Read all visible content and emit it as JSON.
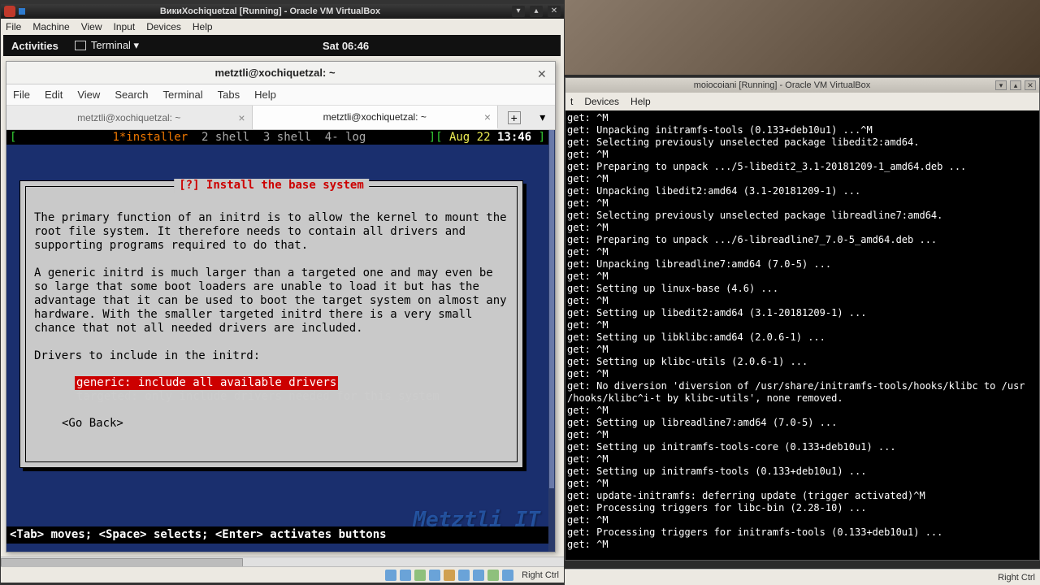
{
  "vm1": {
    "title": "ВикиXochiquetzal [Running] - Oracle VM VirtualBox",
    "menu": [
      "File",
      "Machine",
      "View",
      "Input",
      "Devices",
      "Help"
    ],
    "titlebtns": [
      "▾",
      "▴",
      "✕"
    ],
    "status_right": "Right Ctrl"
  },
  "gnome": {
    "activities": "Activities",
    "app": "Terminal ▾",
    "clock": "Sat 06:46"
  },
  "termwin": {
    "title": "metztli@xochiquetzal: ~",
    "menu": [
      "File",
      "Edit",
      "View",
      "Search",
      "Terminal",
      "Tabs",
      "Help"
    ],
    "tabs": [
      "metztli@xochiquetzal: ~",
      "metztli@xochiquetzal: ~"
    ],
    "status": {
      "left_items": [
        "1*installer",
        "2 shell",
        "3 shell",
        "4- log"
      ],
      "pre_date": "Aug 22",
      "time": "13:46"
    }
  },
  "installer": {
    "title": "[?] Install the base system",
    "p1": "The primary function of an initrd is to allow the kernel to mount the root file system. It therefore needs to contain all drivers and supporting programs required to do that.",
    "p2": "A generic initrd is much larger than a targeted one and may even be so large that some boot loaders are unable to load it but has the advantage that it can be used to boot the target system on almost any hardware. With the smaller targeted initrd there is a very small chance that not all needed drivers are included.",
    "prompt": "Drivers to include in the initrd:",
    "opt_generic": "generic: include all available drivers",
    "opt_targeted": "targeted: only include drivers needed for this system",
    "goback": "<Go Back>",
    "help": "<Tab> moves; <Space> selects; <Enter> activates buttons"
  },
  "watermark": "Metztli IT",
  "vm2": {
    "title": "moiocoiani [Running] - Oracle VM VirtualBox",
    "menu_visible": [
      "t",
      "Devices",
      "Help"
    ],
    "titlebtns": [
      "▾",
      "▴",
      "✕"
    ],
    "status_right": "Right Ctrl",
    "lines": [
      "get: ^M",
      "get: Unpacking initramfs-tools (0.133+deb10u1) ...^M",
      "get: Selecting previously unselected package libedit2:amd64.",
      "get: ^M",
      "get: Preparing to unpack .../5-libedit2_3.1-20181209-1_amd64.deb ...",
      "get: ^M",
      "get: Unpacking libedit2:amd64 (3.1-20181209-1) ...",
      "get: ^M",
      "get: Selecting previously unselected package libreadline7:amd64.",
      "get: ^M",
      "get: Preparing to unpack .../6-libreadline7_7.0-5_amd64.deb ...",
      "get: ^M",
      "get: Unpacking libreadline7:amd64 (7.0-5) ...",
      "get: ^M",
      "get: Setting up linux-base (4.6) ...",
      "get: ^M",
      "get: Setting up libedit2:amd64 (3.1-20181209-1) ...",
      "get: ^M",
      "get: Setting up libklibc:amd64 (2.0.6-1) ...",
      "get: ^M",
      "get: Setting up klibc-utils (2.0.6-1) ...",
      "get: ^M",
      "get: No diversion 'diversion of /usr/share/initramfs-tools/hooks/klibc to /usr",
      "/hooks/klibc^i-t by klibc-utils', none removed.",
      "get: ^M",
      "get: Setting up libreadline7:amd64 (7.0-5) ...",
      "get: ^M",
      "get: Setting up initramfs-tools-core (0.133+deb10u1) ...",
      "get: ^M",
      "get: Setting up initramfs-tools (0.133+deb10u1) ...",
      "get: ^M",
      "get: update-initramfs: deferring update (trigger activated)^M",
      "get: Processing triggers for libc-bin (2.28-10) ...",
      "get: ^M",
      "get: Processing triggers for initramfs-tools (0.133+deb10u1) ...",
      "get: ^M"
    ]
  }
}
